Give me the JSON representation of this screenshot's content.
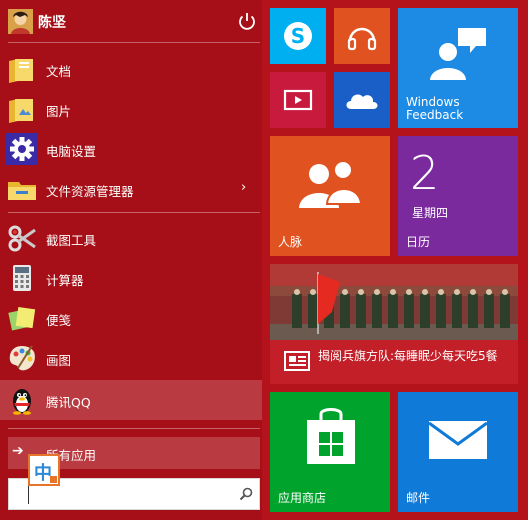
{
  "user": {
    "name": "陈坚",
    "avatar_icon": "user-avatar-icon",
    "power_icon": "power-icon"
  },
  "menu": {
    "items": [
      {
        "label": "文档",
        "icon": "documents-folder-icon"
      },
      {
        "label": "图片",
        "icon": "pictures-folder-icon"
      },
      {
        "label": "电脑设置",
        "icon": "pc-settings-gear-icon"
      },
      {
        "label": "文件资源管理器",
        "icon": "file-explorer-icon",
        "arrow": "›"
      },
      {
        "label": "截图工具",
        "icon": "snipping-tool-icon"
      },
      {
        "label": "计算器",
        "icon": "calculator-icon"
      },
      {
        "label": "便笺",
        "icon": "sticky-notes-icon"
      },
      {
        "label": "画图",
        "icon": "paint-palette-icon"
      },
      {
        "label": "腾讯QQ",
        "icon": "qq-penguin-icon"
      }
    ],
    "all_apps": {
      "label": "所有应用",
      "arrow": "➔"
    }
  },
  "ime": {
    "label": "中"
  },
  "search": {
    "value": "",
    "icon": "search-icon"
  },
  "tiles": {
    "skype": {
      "icon": "skype-icon"
    },
    "music": {
      "icon": "headphones-icon"
    },
    "video": {
      "icon": "video-player-icon"
    },
    "onedrive": {
      "icon": "cloud-icon"
    },
    "feedback": {
      "label": "Windows Feedback",
      "icon": "feedback-people-icon"
    },
    "people": {
      "label": "人脉",
      "icon": "people-icon"
    },
    "calendar": {
      "label": "日历",
      "date": "2",
      "weekday": "星期四"
    },
    "news": {
      "headline": "揭阅兵旗方队:每睡眠少每天吃5餐",
      "icon": "news-icon"
    },
    "store": {
      "label": "应用商店",
      "icon": "store-bag-icon"
    },
    "mail": {
      "label": "邮件",
      "icon": "mail-envelope-icon"
    }
  },
  "colors": {
    "background": "#b5131b",
    "left_pane": "#a60f17",
    "skype": "#00aff0",
    "music": "#e0521f",
    "video": "#c81a3c",
    "onedrive": "#1a5fc7",
    "feedback": "#1d8ae3",
    "people": "#e0521f",
    "calendar": "#7b2a9e",
    "store": "#00a42d",
    "mail": "#0f7ad8"
  }
}
